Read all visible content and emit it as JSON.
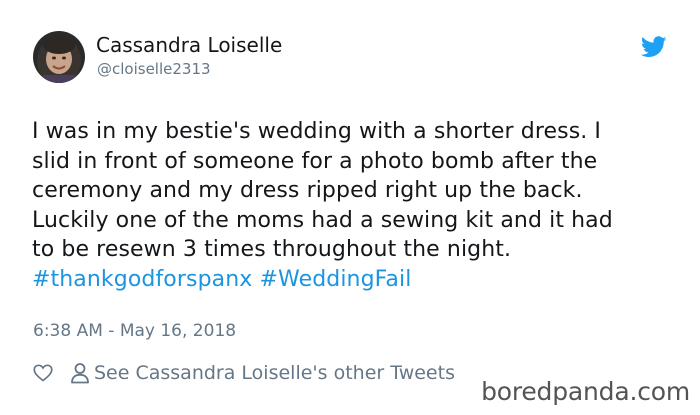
{
  "tweet": {
    "author_name": "Cassandra Loiselle",
    "author_handle": "@cloiselle2313",
    "body_lines": [
      "I was in my bestie's wedding with a shorter dress. I",
      "slid in front of someone for a photo bomb after the",
      "ceremony and my dress ripped right up the back.",
      "Luckily one of the moms had a sewing kit and it had",
      "to be resewn 3 times throughout the night."
    ],
    "hashtags": [
      "#thankgodforspanx",
      "#WeddingFail"
    ],
    "timestamp": "6:38 AM - May 16, 2018",
    "other_tweets_label": "See Cassandra Loiselle's other Tweets"
  },
  "icons": {
    "logo": "twitter-bird-icon",
    "like": "heart-icon",
    "profile": "person-icon"
  },
  "colors": {
    "brand": "#1da1f2",
    "hashtag": "#1b95e0",
    "text_primary": "#14171a",
    "text_secondary": "#657786"
  },
  "watermark": "boredpanda.com"
}
